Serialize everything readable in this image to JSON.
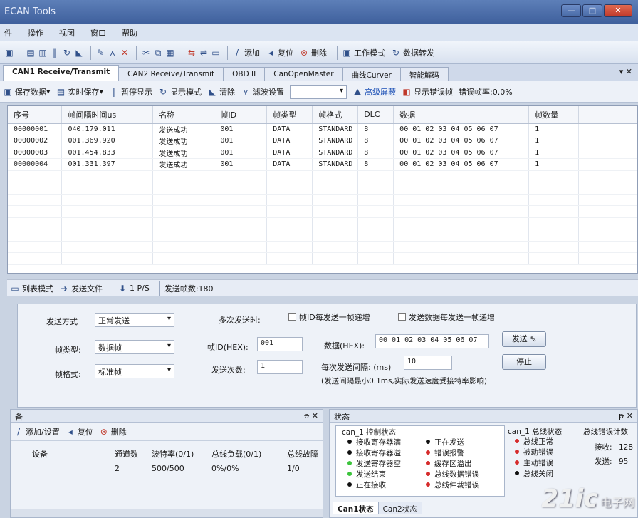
{
  "window": {
    "title": "ECAN Tools",
    "min": "—",
    "max": "□",
    "close": "✕"
  },
  "menu": [
    "件",
    "操作",
    "视图",
    "窗口",
    "帮助"
  ],
  "toolbar": {
    "add": "添加",
    "reset": "复位",
    "delete": "删除",
    "work_mode": "工作模式",
    "data_forward": "数据转发"
  },
  "tabs": [
    "CAN1 Receive/Transmit",
    "CAN2 Receive/Transmit",
    "OBD II",
    "CanOpenMaster",
    "曲线Curver",
    "智能解码"
  ],
  "subtoolbar": {
    "save_data": "保存数据",
    "realtime_save": "实时保存",
    "pause_display": "暂停显示",
    "display_mode": "显示模式",
    "clear": "清除",
    "filter_settings": "滤波设置",
    "advanced_mask": "高级屏蔽",
    "show_error_frame": "显示错误帧",
    "error_rate": "错误帧率:0.0%"
  },
  "table": {
    "columns": [
      "序号",
      "帧间隔时间us",
      "名称",
      "帧ID",
      "帧类型",
      "帧格式",
      "DLC",
      "数据",
      "帧数量"
    ],
    "rows": [
      [
        "00000001",
        "040.179.011",
        "发送成功",
        "001",
        "DATA",
        "STANDARD",
        "8",
        "00 01 02 03 04 05 06 07",
        "1"
      ],
      [
        "00000002",
        "001.369.920",
        "发送成功",
        "001",
        "DATA",
        "STANDARD",
        "8",
        "00 01 02 03 04 05 06 07",
        "1"
      ],
      [
        "00000003",
        "001.454.833",
        "发送成功",
        "001",
        "DATA",
        "STANDARD",
        "8",
        "00 01 02 03 04 05 06 07",
        "1"
      ],
      [
        "00000004",
        "001.331.397",
        "发送成功",
        "001",
        "DATA",
        "STANDARD",
        "8",
        "00 01 02 03 04 05 06 07",
        "1"
      ]
    ]
  },
  "statusbar": {
    "list_mode": "列表模式",
    "send_file": "发送文件",
    "rate": "1 P/S",
    "sent_frames": "发送帧数:180"
  },
  "send": {
    "mode_label": "发送方式",
    "mode_value": "正常发送",
    "multi_label": "多次发送时:",
    "id_inc": "帧ID每发送一帧递增",
    "data_inc": "发送数据每发送一帧递增",
    "frame_type_label": "帧类型:",
    "frame_type_value": "数据帧",
    "frame_id_label": "帧ID(HEX):",
    "frame_id_value": "001",
    "data_label": "数据(HEX):",
    "data_value": "00 01 02 03 04 05 06 07",
    "send_btn": "发送",
    "frame_format_label": "帧格式:",
    "frame_format_value": "标准帧",
    "count_label": "发送次数:",
    "count_value": "1",
    "interval_label": "每次发送间隔: (ms)",
    "interval_value": "10",
    "stop_btn": "停止",
    "note": "(发送间隔最小0.1ms,实际发送速度受接特率影响)"
  },
  "device_panel": {
    "title": "备",
    "add_set": "添加/设置",
    "reset": "复位",
    "delete": "删除",
    "columns": [
      "设备",
      "通道数",
      "波特率(0/1)",
      "总线负载(0/1)",
      "总线故障"
    ],
    "row": [
      "",
      "2",
      "500/500",
      "0%/0%",
      "1/0"
    ]
  },
  "state_panel": {
    "title": "状态",
    "ctrl_title": "can_1 控制状态",
    "ctrl_col1": [
      "接收寄存器满",
      "接收寄存器溢",
      "发送寄存器空",
      "发送结束",
      "正在接收"
    ],
    "ctrl_col2": [
      "正在发送",
      "错误报警",
      "缓存区溢出",
      "总线数据错误",
      "总线仲裁错误"
    ],
    "bus_title": "can_1 总线状态",
    "bus_items": [
      "总线正常",
      "被动错误",
      "主动错误",
      "总线关闭"
    ],
    "err_title": "总线错误计数",
    "rx_label": "接收:",
    "rx_value": "128",
    "tx_label": "发送:",
    "tx_value": "95",
    "tabs": [
      "Can1状态",
      "Can2状态"
    ]
  },
  "watermark": "21ic电子网"
}
